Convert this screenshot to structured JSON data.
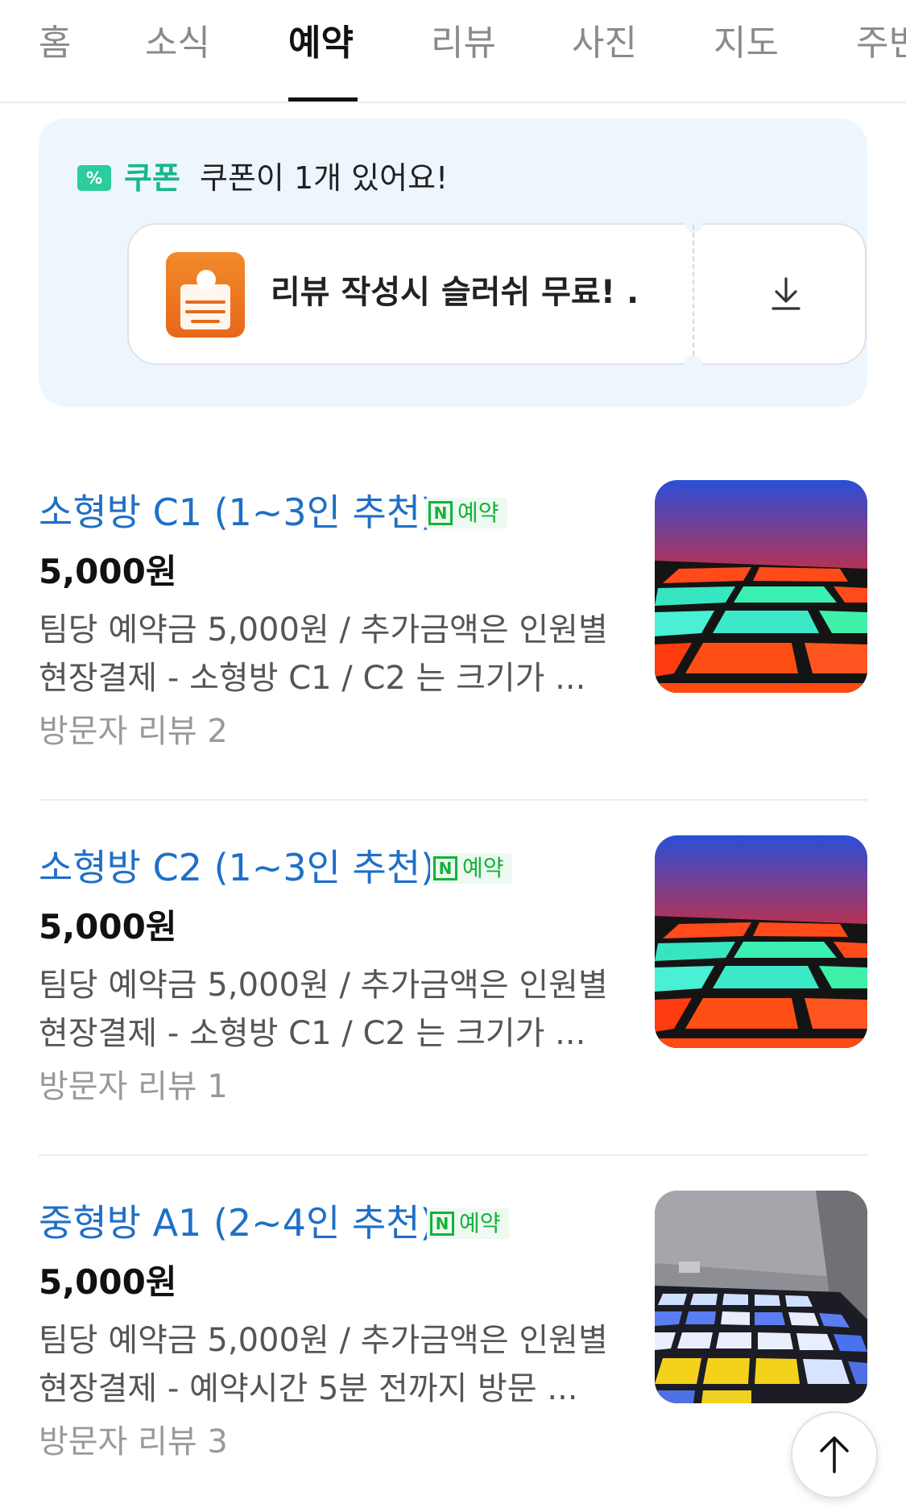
{
  "tabs": [
    {
      "label": "홈",
      "active": false
    },
    {
      "label": "소식",
      "active": false
    },
    {
      "label": "예약",
      "active": true
    },
    {
      "label": "리뷰",
      "active": false
    },
    {
      "label": "사진",
      "active": false
    },
    {
      "label": "지도",
      "active": false
    },
    {
      "label": "주변",
      "active": false
    }
  ],
  "coupon": {
    "icon_symbol": "%",
    "label": "쿠폰",
    "count_text": "쿠폰이 1개 있어요!",
    "title": "리뷰 작성시 슬러쉬 무료! ...",
    "download_icon": "download-icon"
  },
  "items": [
    {
      "title": "소형방 C1 (1~3인 추천)",
      "badge": {
        "letter": "N",
        "text": "예약"
      },
      "price": "5,000원",
      "desc_line1": "팀당 예약금 5,000원 / 추가금액은 인원별",
      "desc_line2": "현장결제 - 소형방 C1 / C2 는 크기가 ...",
      "reviews": "방문자 리뷰 2"
    },
    {
      "title": "소형방 C2 (1~3인 추천)",
      "badge": {
        "letter": "N",
        "text": "예약"
      },
      "price": "5,000원",
      "desc_line1": "팀당 예약금 5,000원 / 추가금액은 인원별",
      "desc_line2": "현장결제 - 소형방 C1 / C2 는 크기가 ...",
      "reviews": "방문자 리뷰 1"
    },
    {
      "title": "중형방 A1 (2~4인 추천)",
      "badge": {
        "letter": "N",
        "text": "예약"
      },
      "price": "5,000원",
      "desc_line1": "팀당 예약금 5,000원 / 추가금액은 인원별",
      "desc_line2": "현장결제 - 예약시간 5분 전까지 방문 ...",
      "reviews": "방문자 리뷰 3"
    }
  ],
  "colors": {
    "accent_blue": "#1f6fc7",
    "coupon_green": "#17b78a",
    "naver_green": "#12b33a"
  }
}
